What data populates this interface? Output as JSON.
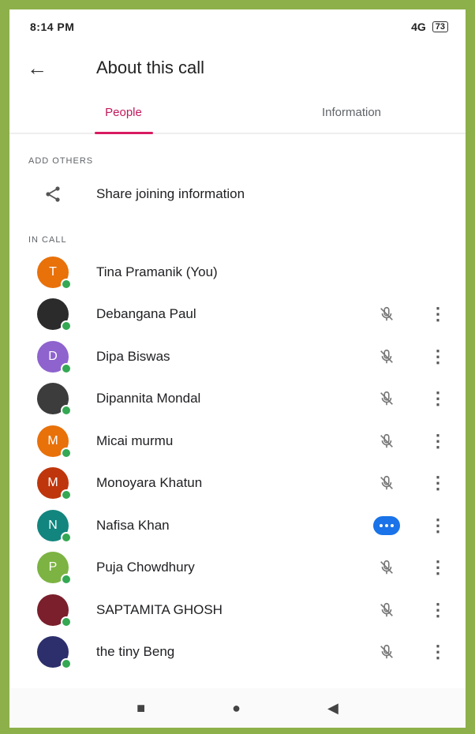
{
  "status_bar": {
    "time": "8:14 PM",
    "signal": "4G",
    "battery": "73"
  },
  "header": {
    "title": "About this call"
  },
  "tabs": [
    {
      "label": "People",
      "active": true
    },
    {
      "label": "Information",
      "active": false
    }
  ],
  "add_others": {
    "section_label": "ADD OTHERS",
    "share_label": "Share joining information"
  },
  "in_call": {
    "section_label": "IN CALL",
    "participants": [
      {
        "name": "Tina Pramanik (You)",
        "initial": "T",
        "avatar_color": "#e8710a",
        "mic": "none"
      },
      {
        "name": "Debangana Paul",
        "initial": "",
        "avatar_color": "#2b2b2b",
        "mic": "muted"
      },
      {
        "name": "Dipa Biswas",
        "initial": "D",
        "avatar_color": "#8e63ce",
        "mic": "muted"
      },
      {
        "name": "Dipannita Mondal",
        "initial": "",
        "avatar_color": "#3c3c3c",
        "mic": "muted"
      },
      {
        "name": "Micai murmu",
        "initial": "M",
        "avatar_color": "#e8710a",
        "mic": "muted"
      },
      {
        "name": "Monoyara Khatun",
        "initial": "M",
        "avatar_color": "#bf360c",
        "mic": "muted"
      },
      {
        "name": "Nafisa Khan",
        "initial": "N",
        "avatar_color": "#12857e",
        "mic": "speaking"
      },
      {
        "name": "Puja Chowdhury",
        "initial": "P",
        "avatar_color": "#7cb342",
        "mic": "muted"
      },
      {
        "name": "SAPTAMITA GHOSH",
        "initial": "",
        "avatar_color": "#7a1f2b",
        "mic": "muted"
      },
      {
        "name": "the tiny Beng",
        "initial": "",
        "avatar_color": "#2c2f6b",
        "mic": "muted"
      }
    ]
  },
  "colors": {
    "accent": "#d81b60",
    "speaking": "#1a73e8"
  }
}
